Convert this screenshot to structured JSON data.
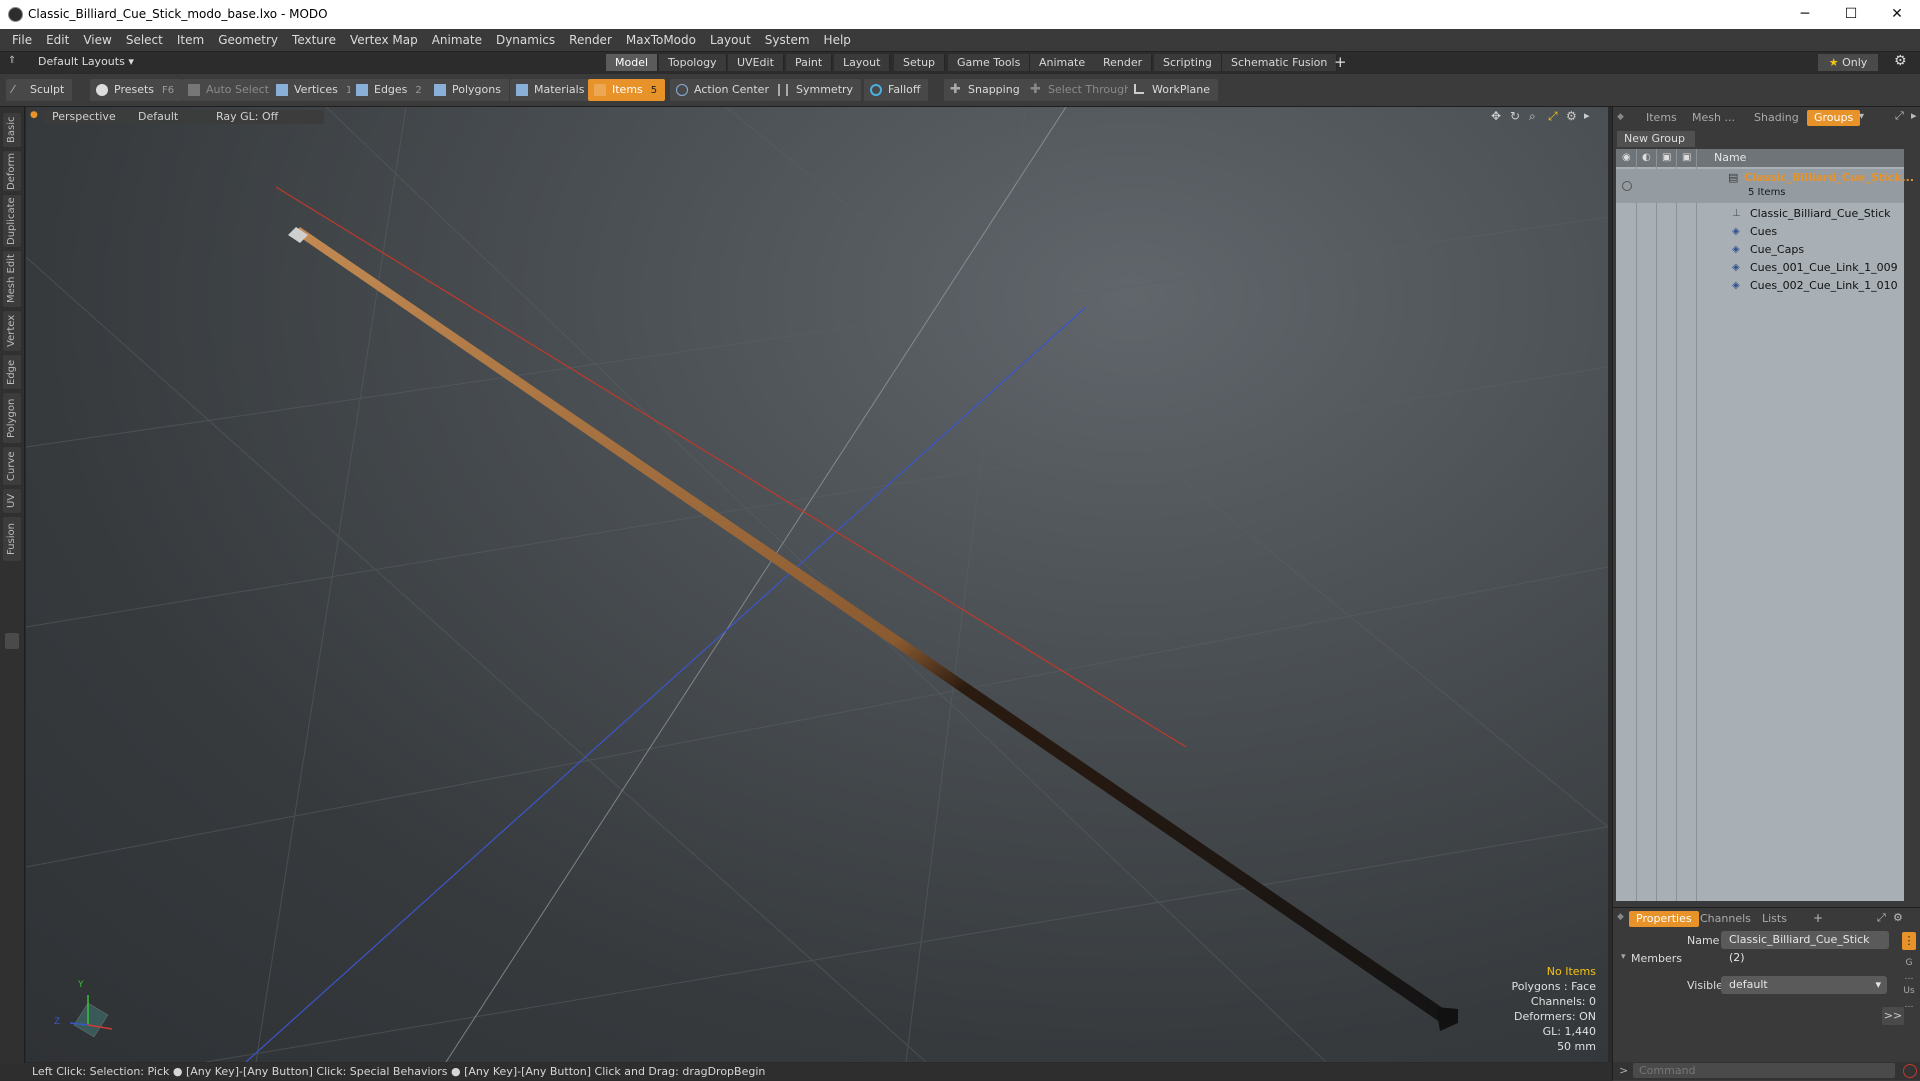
{
  "window": {
    "title": "Classic_Billiard_Cue_Stick_modo_base.lxo - MODO",
    "minimize": "─",
    "maximize": "☐",
    "close": "✕"
  },
  "menubar": [
    "File",
    "Edit",
    "View",
    "Select",
    "Item",
    "Geometry",
    "Texture",
    "Vertex Map",
    "Animate",
    "Dynamics",
    "Render",
    "MaxToModo",
    "Layout",
    "System",
    "Help"
  ],
  "layout_bar": {
    "layouts_label": "Default Layouts",
    "tabs": [
      "Model",
      "Topology",
      "UVEdit",
      "Paint",
      "Layout",
      "Setup",
      "Game Tools",
      "Animate",
      "Render",
      "Scripting",
      "Schematic Fusion"
    ],
    "active_tab": "Model",
    "add": "+",
    "only_label": "Only"
  },
  "toolbar": {
    "sculpt": "Sculpt",
    "presets": "Presets",
    "presets_key": "F6",
    "auto_select": "Auto Select",
    "vertices": "Vertices",
    "vertices_count": "1",
    "edges": "Edges",
    "edges_count": "2",
    "polygons": "Polygons",
    "materials": "Materials",
    "items": "Items",
    "items_count": "5",
    "action_center": "Action Center",
    "symmetry": "Symmetry",
    "falloff": "Falloff",
    "snapping": "Snapping",
    "select_through": "Select Through",
    "workplane": "WorkPlane"
  },
  "left_tabs": [
    "Basic",
    "Deform",
    "Duplicate",
    "Mesh Edit",
    "Vertex",
    "Edge",
    "Polygon",
    "Curve",
    "UV",
    "Fusion"
  ],
  "viewport": {
    "view_mode": "Perspective",
    "shading": "Default",
    "raygl": "Ray GL: Off",
    "info": {
      "selection": "No Items",
      "polygons": "Polygons : Face",
      "channels": "Channels: 0",
      "deformers": "Deformers: ON",
      "gl": "GL: 1,440",
      "scale": "50 mm"
    },
    "axis_labels": {
      "x": "X",
      "y": "Y",
      "z": "Z"
    }
  },
  "statusbar": "Left Click: Selection: Pick ● [Any Key]-[Any Button] Click: Special Behaviors ● [Any Key]-[Any Button] Click and Drag: dragDropBegin",
  "right_panel": {
    "tabs": [
      "Items",
      "Mesh ...",
      "Shading",
      "Groups"
    ],
    "active_tab": "Groups",
    "new_group": "New Group",
    "column_name": "Name",
    "group_name": "Classic_Billiard_Cue_Stick...",
    "group_count": "5 Items",
    "items": [
      "Classic_Billiard_Cue_Stick",
      "Cues",
      "Cue_Caps",
      "Cues_001_Cue_Link_1_009",
      "Cues_002_Cue_Link_1_010"
    ]
  },
  "properties": {
    "tabs": [
      "Properties",
      "Channels",
      "Lists"
    ],
    "active_tab": "Properties",
    "add": "+",
    "name_label": "Name",
    "name_value": "Classic_Billiard_Cue_Stick (2)",
    "members_label": "Members",
    "visible_label": "Visible",
    "visible_value": "default",
    "more": ">>"
  },
  "command": {
    "placeholder": "Command",
    "prompt": ">"
  },
  "colors": {
    "accent": "#e8922a",
    "group_text": "#e8922a",
    "selection_text": "#f3c316"
  }
}
